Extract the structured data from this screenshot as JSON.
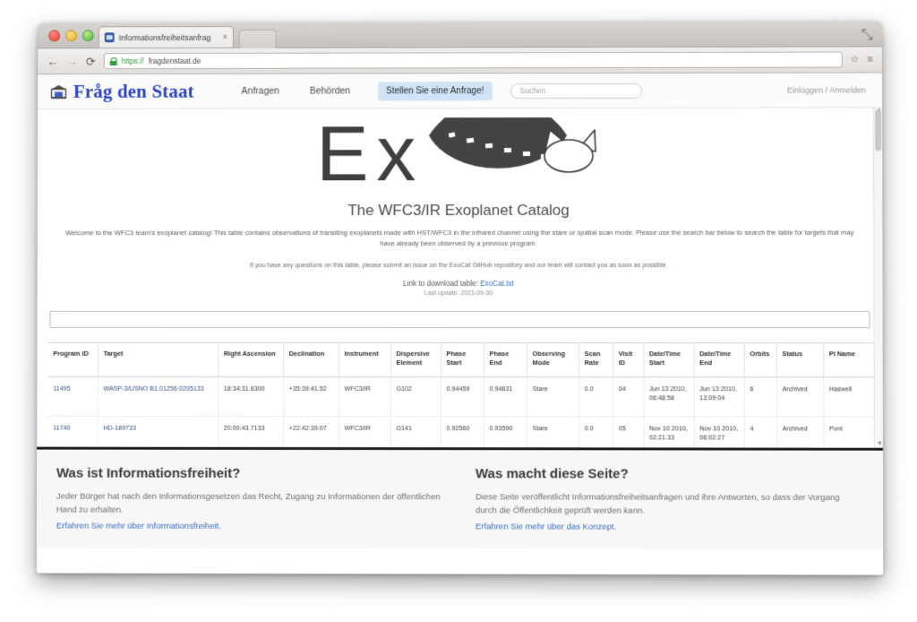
{
  "browser": {
    "tab_title": "Informationsfreiheitsanfrag",
    "tab_close": "×",
    "back": "←",
    "forward": "→",
    "reload": "⟳",
    "url_scheme": "https://",
    "url_host": "fragdenstaat.de",
    "star": "☆",
    "menu": "≡",
    "expand": "⤡"
  },
  "site_header": {
    "logo_text": "Fråg den Staat",
    "nav": [
      {
        "label": "Anfragen"
      },
      {
        "label": "Behörden"
      }
    ],
    "cta_label": "Stellen Sie eine Anfrage!",
    "search_placeholder": "Suchen",
    "auth_label": "Einloggen / Anmelden"
  },
  "hero": {
    "wordmark": "Ex"
  },
  "catalog": {
    "title": "The WFC3/IR Exoplanet Catalog",
    "intro_part1": "Welcome to the WFC3 team's exoplanet catalog! This table contains observations of transiting exoplanets made with HST/WFC3 in the infrared channel using the stare or spatial scan mode. Please use the search bar below to search the table for targets that may have already been observed by a previous program.",
    "note_part1": "If you have any questions on this table, please submit an issue on the ",
    "note_link": "ExoCat GitHub repository",
    "note_part2": " and our team will contact you as soon as possible.",
    "download_label": "Link to download table: ",
    "download_link": "ExoCat.txt",
    "last_update": "Last update: 2021-09-30",
    "table_search_value": ""
  },
  "table": {
    "columns": [
      "Program ID",
      "Target",
      "Right Ascension",
      "Declination",
      "Instrument",
      "Dispersive Element",
      "Phase Start",
      "Phase End",
      "Observing Mode",
      "Scan Rate",
      "Visit ID",
      "Date/Time Start",
      "Date/Time End",
      "Orbits",
      "Status",
      "PI Name"
    ],
    "rows": [
      {
        "program_id": "11495",
        "target": "WASP-3/USNO B1.01256 0205133",
        "right_ascension": "18:34:31.6300",
        "declination": "+35:39:41.52",
        "instrument": "WFC3/IR",
        "dispersive_element": "G102",
        "phase_start": "0.94459",
        "phase_end": "0.94631",
        "observing_mode": "Stare",
        "scan_rate": "0.0",
        "visit_id": "04",
        "datetime_start_date": "Jun 13 2010,",
        "datetime_start_time": "06:48:58",
        "datetime_end_date": "Jun 13 2010,",
        "datetime_end_time": "13:09:04",
        "orbits": "6",
        "status": "Archived",
        "pi_name": "Haswell"
      },
      {
        "program_id": "11740",
        "target": "HD-189733",
        "right_ascension": "20:00:43.7133",
        "declination": "+22:42:39.07",
        "instrument": "WFC3/IR",
        "dispersive_element": "G141",
        "phase_start": "0.92560",
        "phase_end": "0.93590",
        "observing_mode": "Stare",
        "scan_rate": "0.0",
        "visit_id": "05",
        "datetime_start_date": "Nov 10 2010,",
        "datetime_start_time": "02:21:33",
        "datetime_end_date": "Nov 10 2010,",
        "datetime_end_time": "06:02:27",
        "orbits": "4",
        "status": "Archived",
        "pi_name": "Pont"
      }
    ]
  },
  "footer": {
    "columns": [
      {
        "heading": "Was ist Informationsfreiheit?",
        "body": "Jeder Bürger hat nach den Informationsgesetzen das Recht, Zugang zu Informationen der öffentlichen Hand zu erhalten.",
        "link": "Erfahren Sie mehr über Informationsfreiheit."
      },
      {
        "heading": "Was macht diese Seite?",
        "body": "Diese Seite veröffentlicht Informationsfreiheitsanfragen und ihre Antworten, so dass der Vorgang durch die Öffentlichkeit geprüft werden kann.",
        "link": "Erfahren Sie mehr über das Konzept."
      }
    ]
  },
  "colors": {
    "brand_blue": "#2b45c4",
    "link_blue": "#3a6fc4",
    "cta_bg": "#cfe5f7",
    "planet_dark": "#434343"
  }
}
